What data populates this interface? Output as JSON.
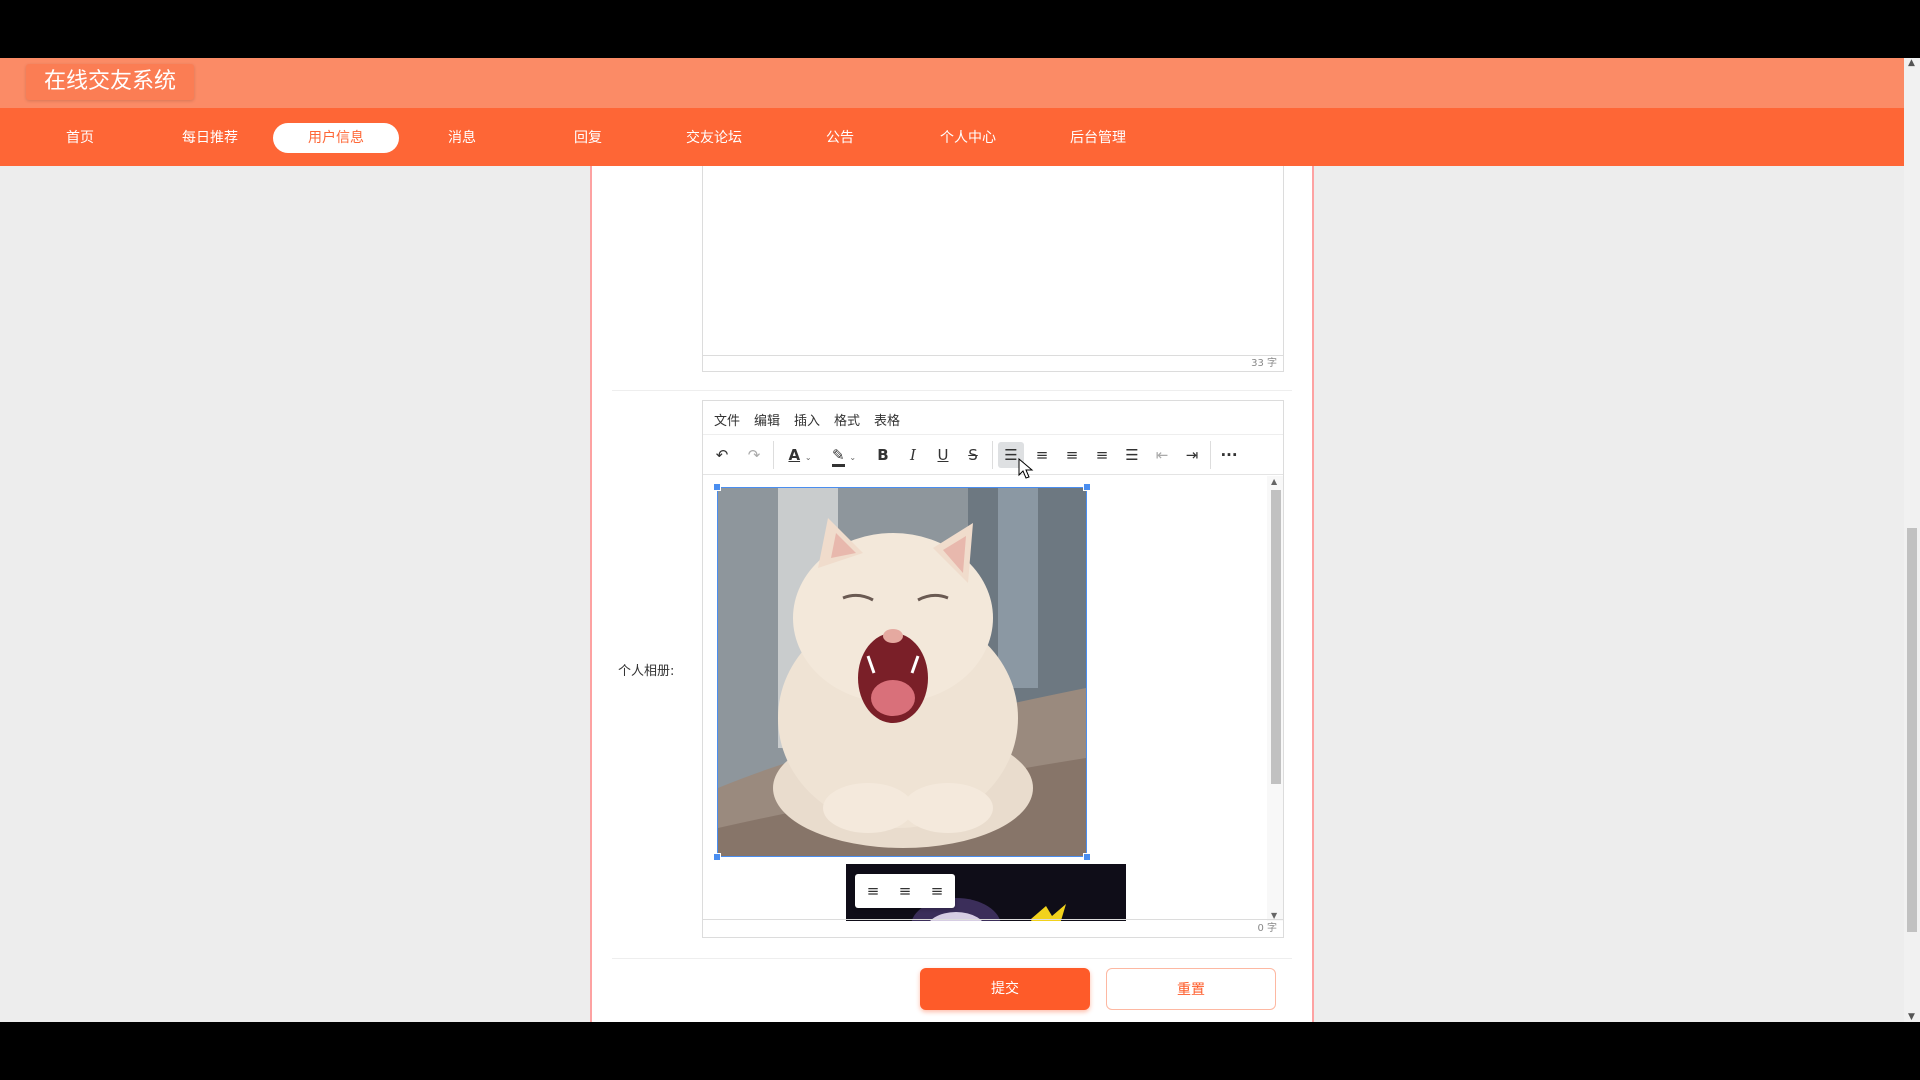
{
  "app": {
    "title": "在线交友系统"
  },
  "nav": {
    "items": [
      {
        "label": "首页",
        "active": false
      },
      {
        "label": "每日推荐",
        "active": false
      },
      {
        "label": "用户信息",
        "active": true
      },
      {
        "label": "消息",
        "active": false
      },
      {
        "label": "回复",
        "active": false
      },
      {
        "label": "交友论坛",
        "active": false
      },
      {
        "label": "公告",
        "active": false
      },
      {
        "label": "个人中心",
        "active": false
      },
      {
        "label": "后台管理",
        "active": false
      }
    ]
  },
  "editor1": {
    "word_count": "33 字"
  },
  "album": {
    "label": "个人相册:",
    "menu": [
      "文件",
      "编辑",
      "插入",
      "格式",
      "表格"
    ],
    "toolbar": [
      "undo-icon",
      "redo-icon",
      "text-color-icon",
      "highlight-color-icon",
      "bold-icon",
      "italic-icon",
      "underline-icon",
      "strikethrough-icon",
      "line-height-icon",
      "align-left-icon",
      "align-center-icon",
      "align-right-icon",
      "align-justify-icon",
      "outdent-icon",
      "indent-icon",
      "more-icon"
    ],
    "word_count": "0 字"
  },
  "buttons": {
    "submit": "提交",
    "reset": "重置"
  },
  "colors": {
    "primary": "#fe6636",
    "header_top": "#fb8b66",
    "selection": "#4a8ef0"
  }
}
